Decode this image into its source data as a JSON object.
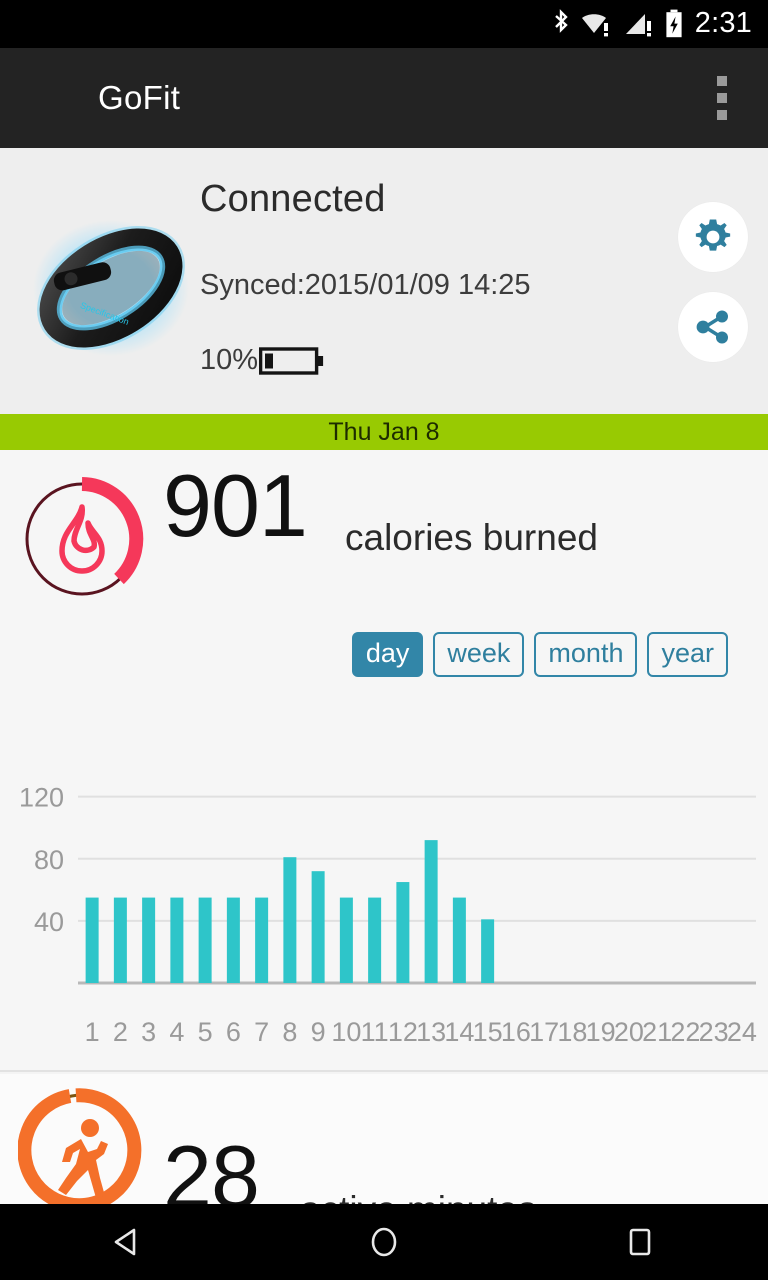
{
  "status_bar": {
    "time": "2:31",
    "icons": [
      "bluetooth-icon",
      "wifi-warning-icon",
      "cellular-warning-icon",
      "battery-charging-icon"
    ]
  },
  "action_bar": {
    "title": "GoFit",
    "overflow_label": "overflow-menu"
  },
  "device": {
    "image_name": "fitness-band-image",
    "status": "Connected",
    "synced": "Synced:2015/01/09 14:25",
    "battery_percent": "10%",
    "battery_level": 10,
    "settings_icon": "gear-icon",
    "share_icon": "share-icon",
    "accent_color": "#3286a8"
  },
  "date_bar": {
    "label": "Thu Jan 8",
    "color": "#98ca02"
  },
  "calories": {
    "icon": "flame-ring-icon",
    "value": "901",
    "label": "calories burned",
    "ring_color": "#f5385a",
    "ring_track_color": "#5a1420",
    "ring_progress_percent": 45
  },
  "period_tabs": [
    {
      "label": "day",
      "selected": true
    },
    {
      "label": "week",
      "selected": false
    },
    {
      "label": "month",
      "selected": false
    },
    {
      "label": "year",
      "selected": false
    }
  ],
  "active_minutes": {
    "icon": "runner-ring-icon",
    "value": "28",
    "label": "active minutes",
    "ring_color": "#f4702a",
    "ring_track_color": "#7a5512",
    "ring_progress_percent": 93
  },
  "nav_bar": {
    "back": "back-triangle-icon",
    "home": "home-circle-icon",
    "recents": "recents-square-icon"
  },
  "chart_data": {
    "type": "bar",
    "title": "",
    "xlabel": "",
    "ylabel": "",
    "categories": [
      "1",
      "2",
      "3",
      "4",
      "5",
      "6",
      "7",
      "8",
      "9",
      "10",
      "11",
      "12",
      "13",
      "14",
      "15",
      "16",
      "17",
      "18",
      "19",
      "20",
      "21",
      "22",
      "23",
      "24"
    ],
    "values": [
      55,
      55,
      55,
      55,
      55,
      55,
      55,
      81,
      72,
      55,
      55,
      65,
      92,
      55,
      41,
      0,
      0,
      0,
      0,
      0,
      0,
      0,
      0,
      0
    ],
    "yticks": [
      40,
      80,
      120
    ],
    "ylim": [
      0,
      132
    ],
    "grid": true,
    "bar_color": "#2ec5c9",
    "axis_text_color": "#9a9a9a",
    "legend": []
  }
}
